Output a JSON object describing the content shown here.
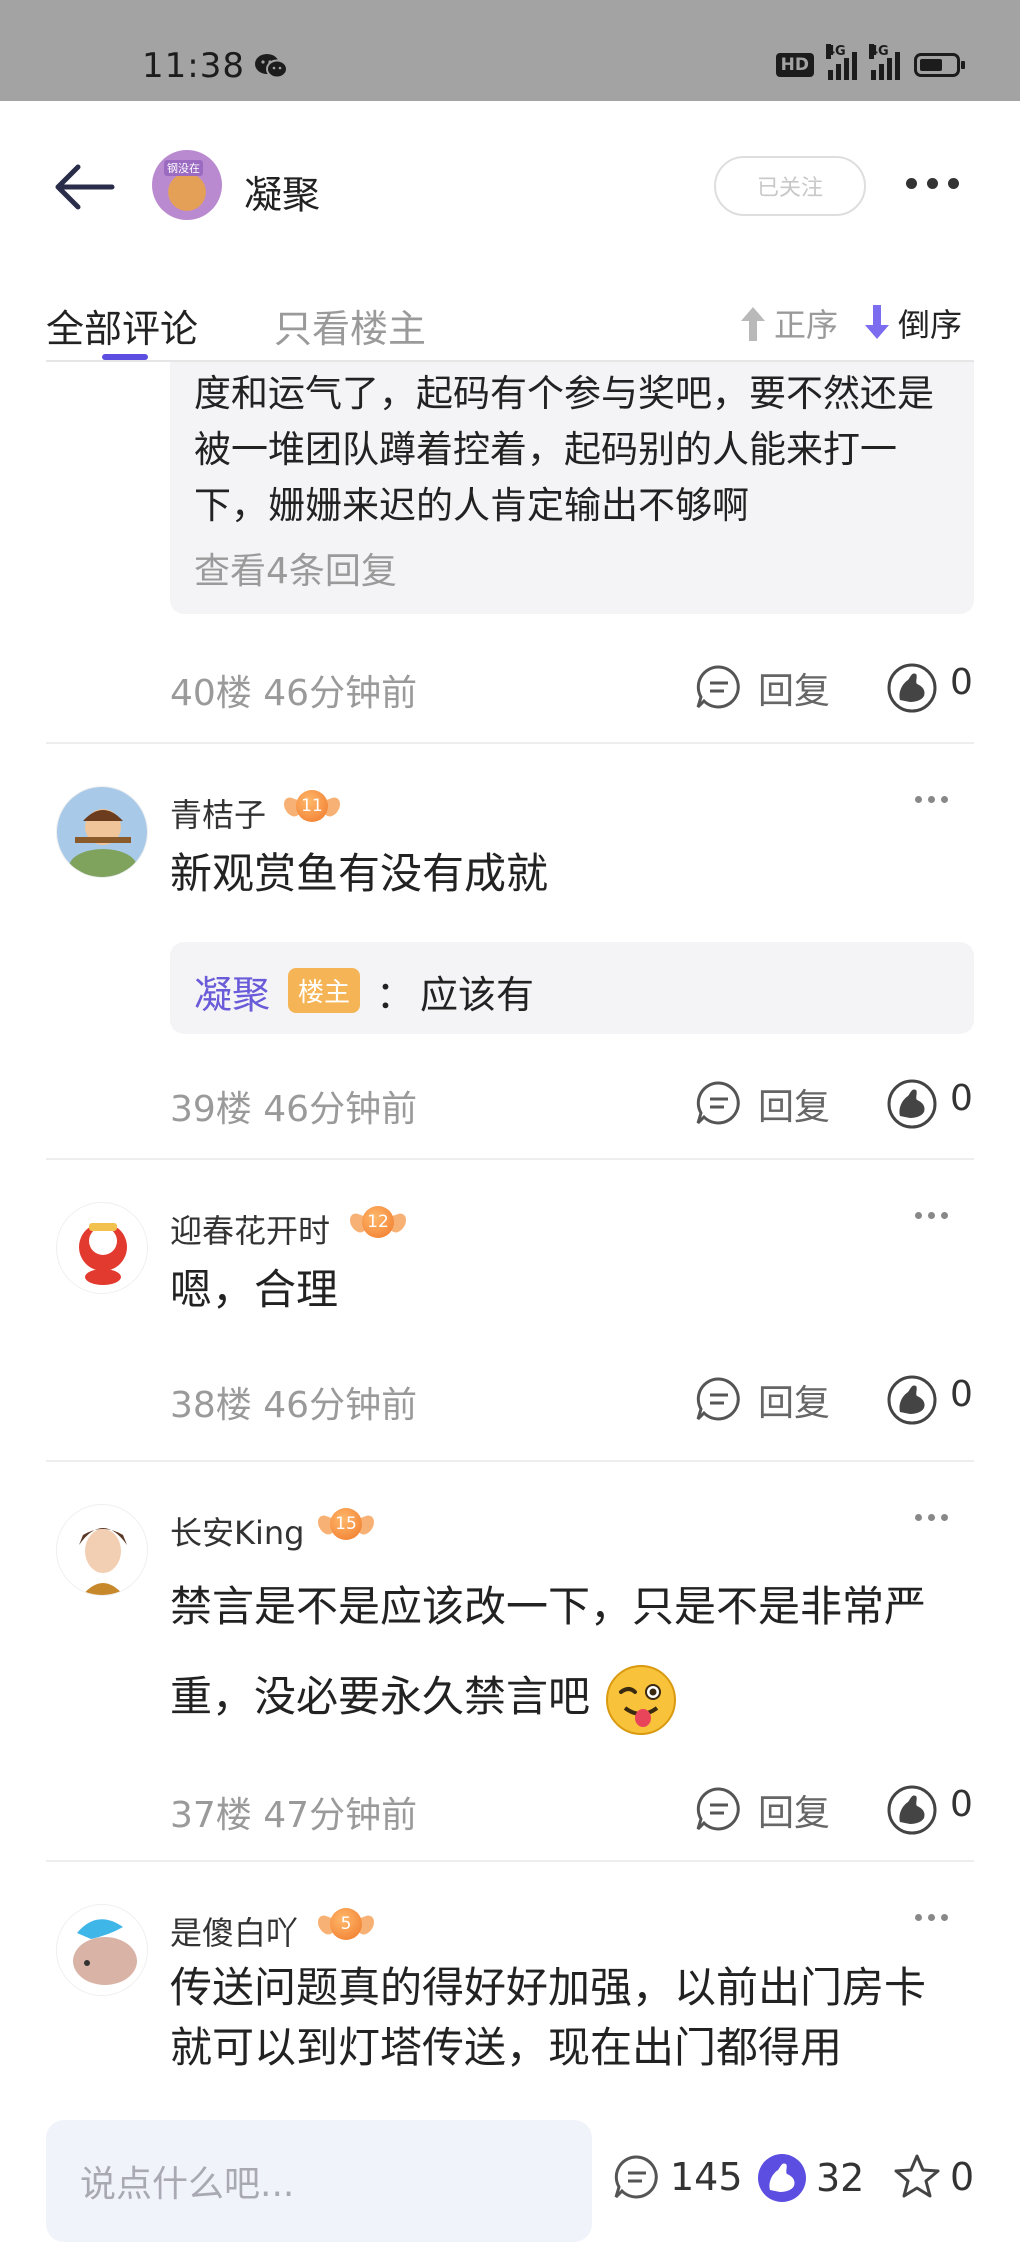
{
  "status_bar": {
    "time": "11:38",
    "hd_label": "HD",
    "signal1_label": "4G",
    "signal2_label": "4G"
  },
  "header": {
    "title": "凝聚",
    "avatar_tag": "钢没在",
    "follow_label": "已关注"
  },
  "tabs": {
    "all_comments": "全部评论",
    "op_only": "只看楼主",
    "sort_asc": "正序",
    "sort_desc": "倒序"
  },
  "top_partial": {
    "text": "度和运气了，起码有个参与奖吧，要不然还是被一堆团队蹲着控着，起码别的人能来打一下，姗姗来迟的人肯定输出不够啊",
    "view_replies": "查看4条回复",
    "floor": "40楼",
    "time": "46分钟前",
    "reply_label": "回复",
    "likes": "0"
  },
  "comments": [
    {
      "name": "青桔子",
      "level": "11",
      "text": "新观赏鱼有没有成就",
      "sub_reply": {
        "author": "凝聚",
        "badge": "楼主",
        "colon": "：",
        "text": "应该有"
      },
      "floor": "39楼",
      "time": "46分钟前",
      "reply_label": "回复",
      "likes": "0"
    },
    {
      "name": "迎春花开时",
      "level": "12",
      "text": "嗯，合理",
      "floor": "38楼",
      "time": "46分钟前",
      "reply_label": "回复",
      "likes": "0"
    },
    {
      "name": "长安King",
      "level": "15",
      "text": "禁言是不是应该改一下，只是不是非常严重，没必要永久禁言吧",
      "floor": "37楼",
      "time": "47分钟前",
      "reply_label": "回复",
      "likes": "0"
    },
    {
      "name": "是傻白吖",
      "level": "5",
      "text": "传送问题真的得好好加强，以前出门房卡就可以到灯塔传送，现在出门都得用"
    }
  ],
  "bottom_bar": {
    "input_placeholder": "说点什么吧...",
    "comment_count": "145",
    "like_count": "32",
    "fav_count": "0"
  },
  "colors": {
    "accent": "#5b4ee0",
    "op_name": "#6a5bd8",
    "op_badge": "#f5b557",
    "level_badge": "#f0782a",
    "status_bar_bg": "#a3a3a3"
  },
  "icons": [
    "back-arrow-icon",
    "wechat-icon",
    "signal-icon",
    "battery-icon",
    "more-icon",
    "arrow-up-icon",
    "arrow-down-icon",
    "reply-icon",
    "like-icon",
    "comment-icon",
    "star-icon",
    "wink-emoji-icon"
  ]
}
